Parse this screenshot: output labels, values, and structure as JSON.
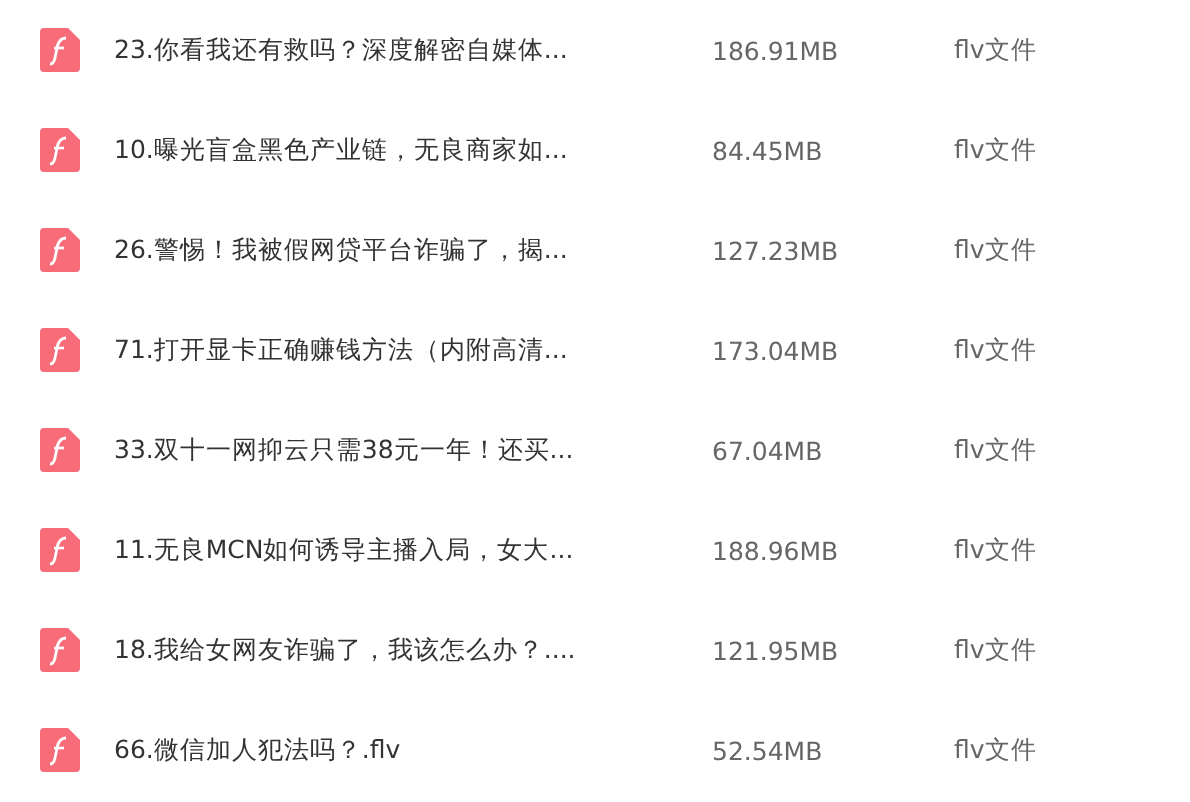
{
  "files": [
    {
      "name": "23.你看我还有救吗？深度解密自媒体...",
      "size": "186.91MB",
      "type": "flv文件"
    },
    {
      "name": "10.曝光盲盒黑色产业链，无良商家如...",
      "size": "84.45MB",
      "type": "flv文件"
    },
    {
      "name": "26.警惕！我被假网贷平台诈骗了，揭...",
      "size": "127.23MB",
      "type": "flv文件"
    },
    {
      "name": "71.打开显卡正确赚钱方法（内附高清...",
      "size": "173.04MB",
      "type": "flv文件"
    },
    {
      "name": "33.双十一网抑云只需38元一年！还买...",
      "size": "67.04MB",
      "type": "flv文件"
    },
    {
      "name": "11.无良MCN如何诱导主播入局，女大...",
      "size": "188.96MB",
      "type": "flv文件"
    },
    {
      "name": "18.我给女网友诈骗了，我该怎么办？....",
      "size": "121.95MB",
      "type": "flv文件"
    },
    {
      "name": "66.微信加人犯法吗？.flv",
      "size": "52.54MB",
      "type": "flv文件"
    }
  ]
}
